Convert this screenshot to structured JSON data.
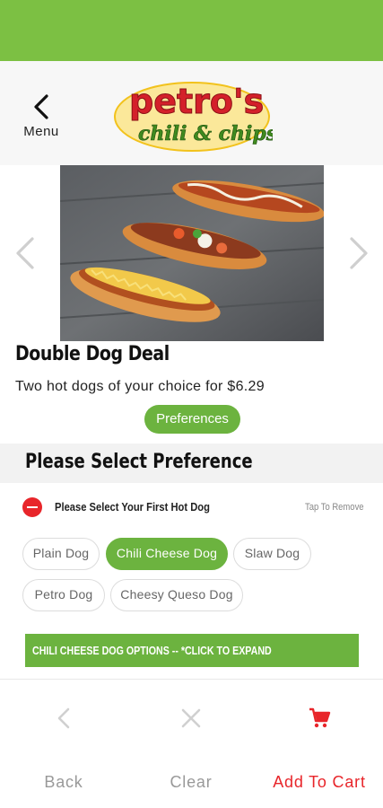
{
  "header": {
    "menu_label": "Menu",
    "logo_text_top": "petro's",
    "logo_text_bottom": "chili & chips"
  },
  "product": {
    "name": "Double Dog Deal",
    "description": "Two hot dogs of your choice for $6.29",
    "preferences_button": "Preferences"
  },
  "preferences": {
    "section_title": "Please Select Preference",
    "selection_label": "Please Select Your First Hot Dog",
    "tap_to_remove": "Tap To Remove",
    "options": [
      {
        "label": "Plain Dog",
        "selected": false
      },
      {
        "label": "Chili Cheese Dog",
        "selected": true
      },
      {
        "label": "Slaw Dog",
        "selected": false
      },
      {
        "label": "Petro Dog",
        "selected": false
      },
      {
        "label": "Cheesy Queso Dog",
        "selected": false
      }
    ],
    "expand_label": "CHILI CHEESE DOG OPTIONS -- *CLICK TO EXPAND"
  },
  "bottom_nav": {
    "back": "Back",
    "clear": "Clear",
    "add_to_cart": "Add To Cart"
  },
  "icons": {
    "back_nav": "chevron-left-icon",
    "carousel_prev": "chevron-left-icon",
    "carousel_next": "chevron-right-icon",
    "remove": "minus-circle-icon",
    "bottom_back": "chevron-left-icon",
    "clear": "close-icon",
    "cart": "cart-icon"
  },
  "colors": {
    "brand_green": "#6cb33f",
    "status_green": "#7cc043",
    "accent_red": "#e8252a"
  }
}
